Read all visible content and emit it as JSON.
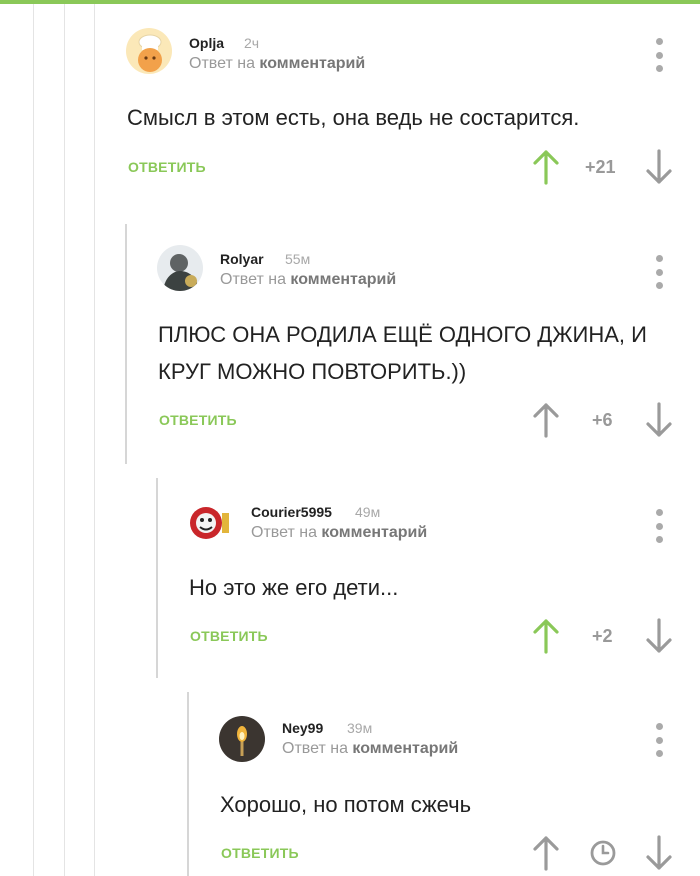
{
  "theme": {
    "accent": "#8ac858",
    "muted": "#999999",
    "arrow_gray": "#9a9a9a"
  },
  "comments": [
    {
      "author": "Oplja",
      "time": "2ч",
      "reply_prefix": "Ответ на",
      "reply_target": "комментарий",
      "text": "Смысл в этом есть, она ведь не состарится.",
      "reply_button": "ОТВЕТИТЬ",
      "score": "+21",
      "upvoted": true,
      "avatar_icon": "chef-avatar-icon"
    },
    {
      "author": "Rolyar",
      "time": "55м",
      "reply_prefix": "Ответ на",
      "reply_target": "комментарий",
      "text_lines": [
        "ПЛЮС ОНА РОДИЛА ЕЩЁ ОДНОГО ДЖИНА, И",
        "КРУГ МОЖНО ПОВТОРИТЬ.))"
      ],
      "reply_button": "ОТВЕТИТЬ",
      "score": "+6",
      "upvoted": false,
      "avatar_icon": "person-photo-avatar-icon"
    },
    {
      "author": "Courier5995",
      "time": "49м",
      "reply_prefix": "Ответ на",
      "reply_target": "комментарий",
      "text": "Но это же его дети...",
      "reply_button": "ОТВЕТИТЬ",
      "score": "+2",
      "upvoted": true,
      "avatar_icon": "cartoon-face-avatar-icon"
    },
    {
      "author": "Ney99",
      "time": "39м",
      "reply_prefix": "Ответ на",
      "reply_target": "комментарий",
      "text": "Хорошо, но потом сжечь",
      "reply_button": "ОТВЕТИТЬ",
      "score_icon": "clock-icon",
      "upvoted": false,
      "avatar_icon": "torch-avatar-icon"
    }
  ]
}
